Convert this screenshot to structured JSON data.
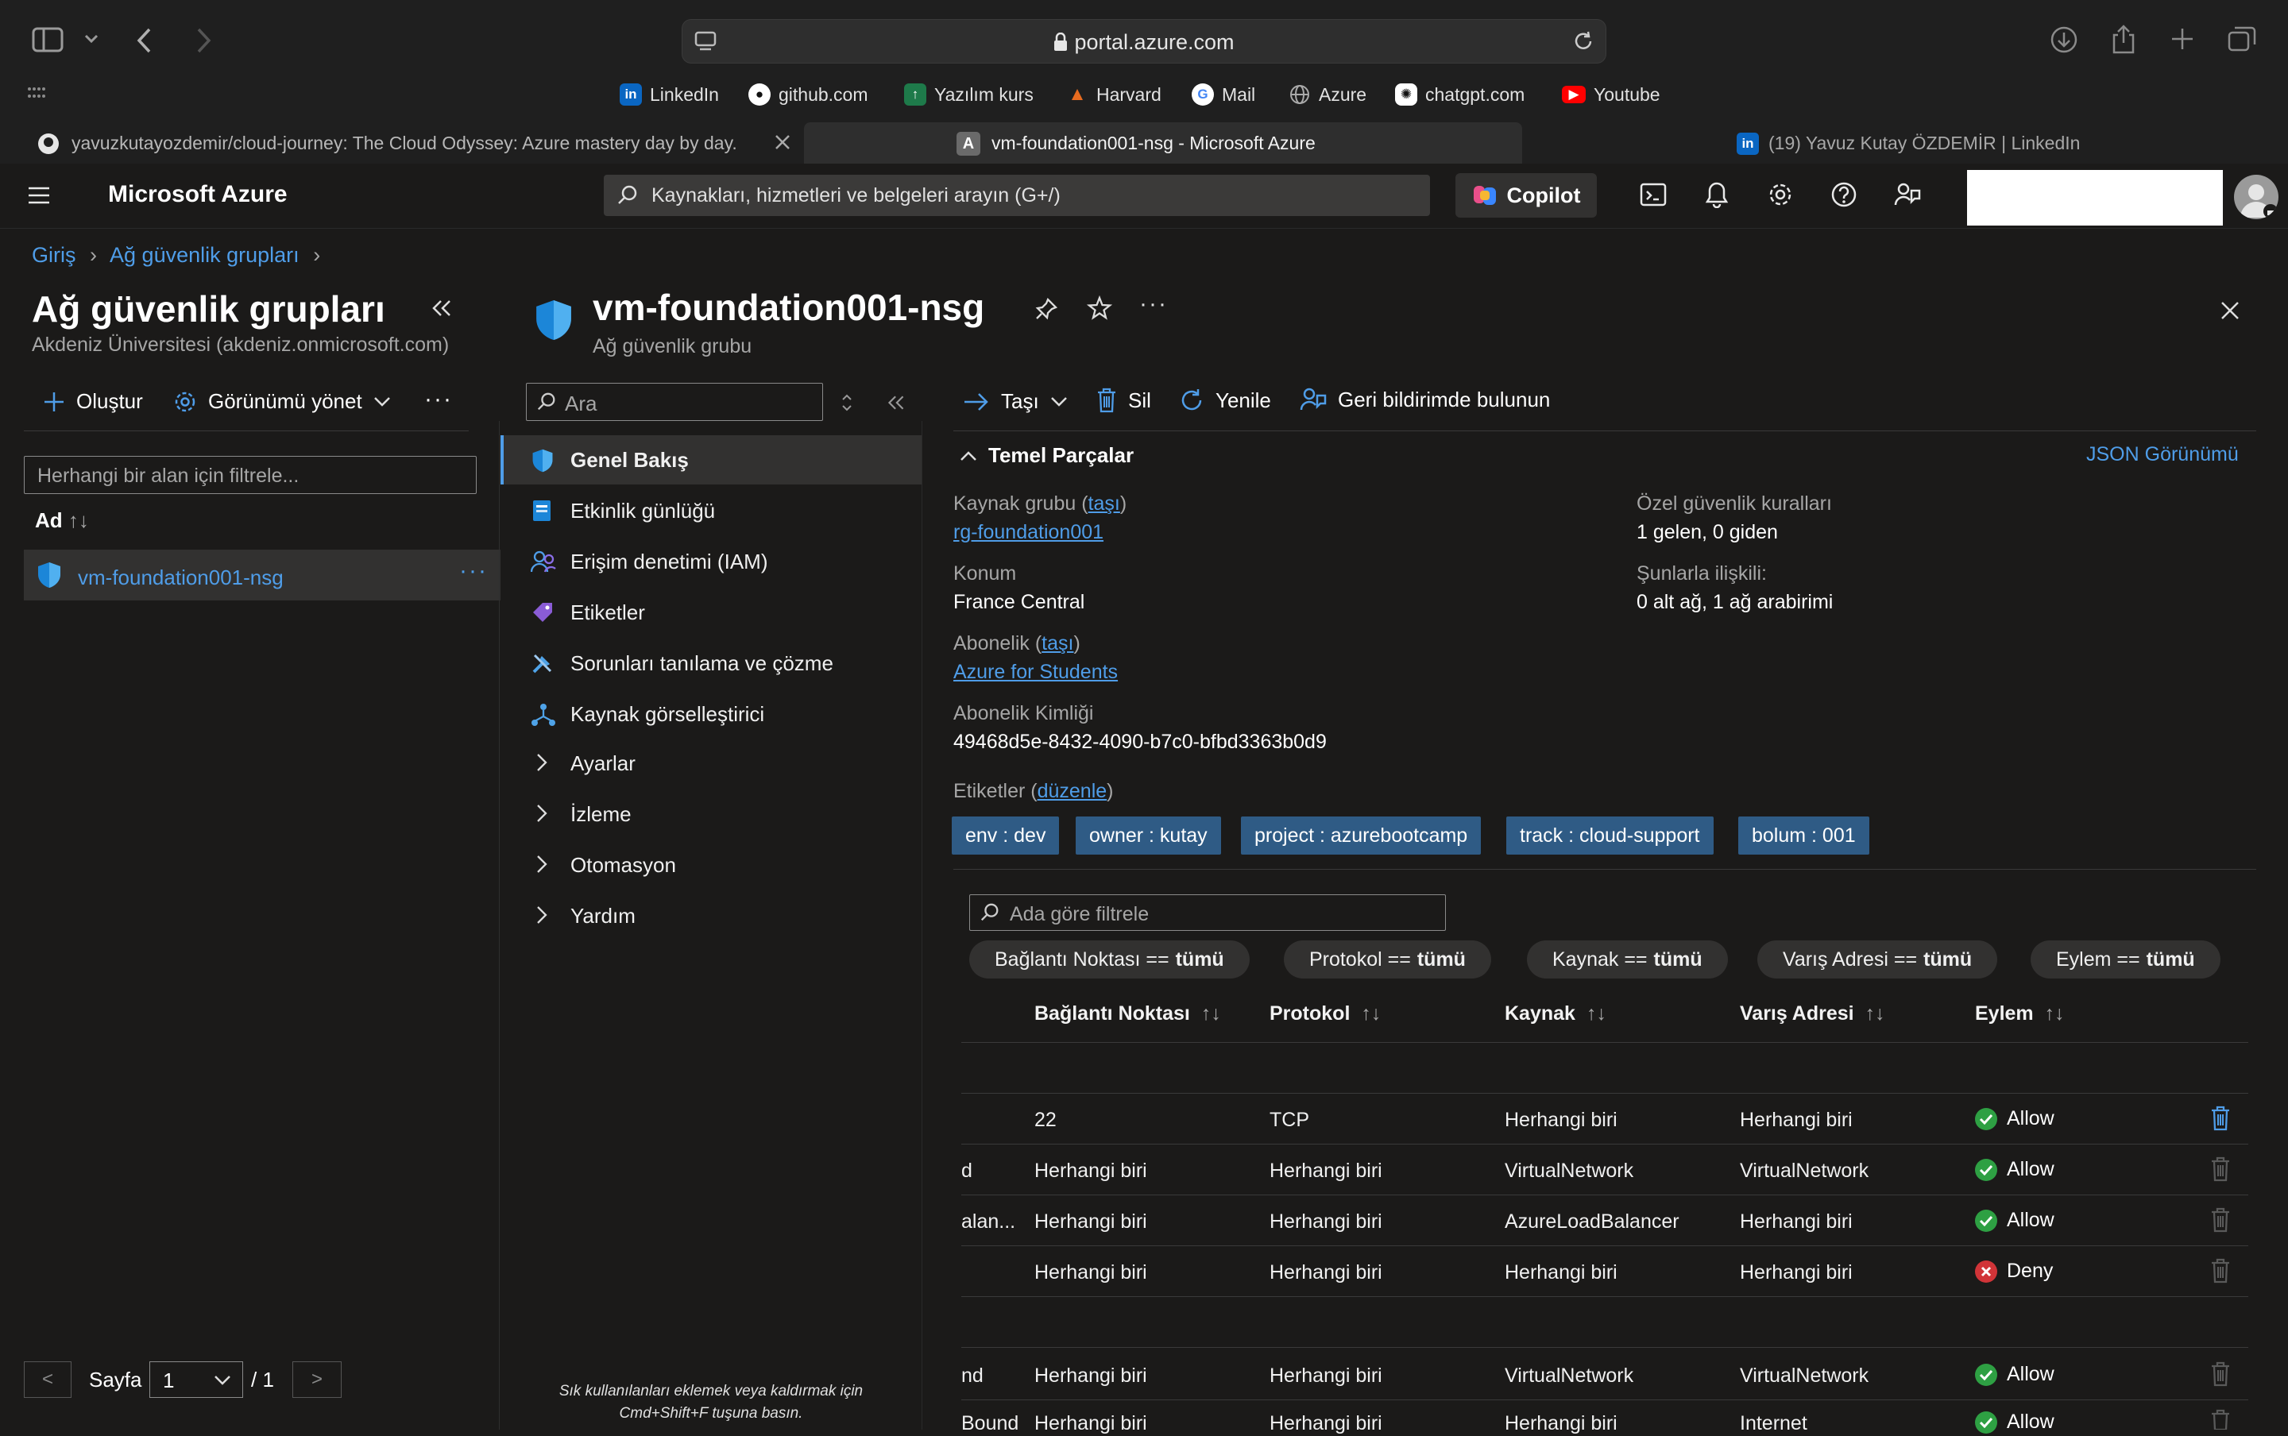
{
  "browser": {
    "url": "portal.azure.com",
    "favorites": [
      {
        "label": "LinkedIn",
        "icon": "linkedin-icon"
      },
      {
        "label": "github.com",
        "icon": "github-icon"
      },
      {
        "label": "Yazılım kurs",
        "icon": "bookmark-icon"
      },
      {
        "label": "Harvard",
        "icon": "harvard-icon"
      },
      {
        "label": "Mail",
        "icon": "google-icon"
      },
      {
        "label": "Azure",
        "icon": "globe-icon"
      },
      {
        "label": "chatgpt.com",
        "icon": "chatgpt-icon"
      },
      {
        "label": "Youtube",
        "icon": "youtube-icon"
      }
    ],
    "tabs": [
      {
        "title": "yavuzkutayozdemir/cloud-journey: The Cloud Odyssey: Azure mastery day by day."
      },
      {
        "title": "vm-foundation001-nsg - Microsoft Azure",
        "favicon": "A"
      },
      {
        "title": "(19) Yavuz Kutay ÖZDEMİR | LinkedIn"
      }
    ]
  },
  "header": {
    "brand": "Microsoft Azure",
    "search_placeholder": "Kaynakları, hizmetleri ve belgeleri arayın (G+/)",
    "copilot": "Copilot"
  },
  "breadcrumb": {
    "home": "Giriş",
    "section": "Ağ güvenlik grupları"
  },
  "list_pane": {
    "title": "Ağ güvenlik grupları",
    "subtitle": "Akdeniz Üniversitesi (akdeniz.onmicrosoft.com)",
    "create": "Oluştur",
    "manage_view": "Görünümü yönet",
    "filter_placeholder": "Herhangi bir alan için filtrele...",
    "col_name": "Ad",
    "items": [
      {
        "name": "vm-foundation001-nsg"
      }
    ],
    "page_label": "Sayfa",
    "page_value": "1",
    "page_total": "/ 1",
    "prev": "<",
    "next": ">"
  },
  "resource": {
    "title": "vm-foundation001-nsg",
    "subtitle": "Ağ güvenlik grubu",
    "search_placeholder": "Ara",
    "nav": [
      {
        "label": "Genel Bakış",
        "icon": "shield-icon",
        "active": true
      },
      {
        "label": "Etkinlik günlüğü",
        "icon": "activity-log-icon"
      },
      {
        "label": "Erişim denetimi (IAM)",
        "icon": "people-icon"
      },
      {
        "label": "Etiketler",
        "icon": "tag-icon"
      },
      {
        "label": "Sorunları tanılama ve çözme",
        "icon": "wrench-icon"
      },
      {
        "label": "Kaynak görselleştirici",
        "icon": "visualizer-icon"
      },
      {
        "label": "Ayarlar",
        "expandable": true
      },
      {
        "label": "İzleme",
        "expandable": true
      },
      {
        "label": "Otomasyon",
        "expandable": true
      },
      {
        "label": "Yardım",
        "expandable": true
      }
    ],
    "nav_hint_line1": "Sık kullanılanları eklemek veya kaldırmak için",
    "nav_hint_line2": "Cmd+Shift+F tuşuna basın."
  },
  "toolbar": {
    "move": "Taşı",
    "delete": "Sil",
    "refresh": "Yenile",
    "feedback": "Geri bildirimde bulunun"
  },
  "essentials": {
    "title": "Temel Parçalar",
    "json_view": "JSON Görünümü",
    "rg_label": "Kaynak grubu (",
    "move_link": "taşı",
    "close_paren": ")",
    "rg_value": "rg-foundation001",
    "location_label": "Konum",
    "location_value": "France Central",
    "sub_label": "Abonelik (",
    "sub_value": "Azure for Students",
    "sub_id_label": "Abonelik Kimliği",
    "sub_id_value": "49468d5e-8432-4090-b7c0-bfbd3363b0d9",
    "rules_label": "Özel güvenlik kuralları",
    "rules_value": "1 gelen, 0 giden",
    "assoc_label": "Şunlarla ilişkili:",
    "assoc_value": "0 alt ağ, 1 ağ arabirimi",
    "tags_label": "Etiketler (",
    "tags_edit": "düzenle",
    "tags": [
      "env : dev",
      "owner : kutay",
      "project : azurebootcamp",
      "track : cloud-support",
      "bolum : 001"
    ]
  },
  "rules": {
    "filter_placeholder": "Ada göre filtrele",
    "pills": [
      {
        "label": "Bağlantı Noktası ==",
        "value": "tümü"
      },
      {
        "label": "Protokol ==",
        "value": "tümü"
      },
      {
        "label": "Kaynak ==",
        "value": "tümü"
      },
      {
        "label": "Varış Adresi ==",
        "value": "tümü"
      },
      {
        "label": "Eylem ==",
        "value": "tümü"
      }
    ],
    "columns": [
      "Bağlantı Noktası",
      "Protokol",
      "Kaynak",
      "Varış Adresi",
      "Eylem"
    ],
    "rows": [
      {
        "name": "",
        "port": "22",
        "protocol": "TCP",
        "source": "Herhangi biri",
        "dest": "Herhangi biri",
        "action": "Allow",
        "status": "allow"
      },
      {
        "name": "d",
        "port": "Herhangi biri",
        "protocol": "Herhangi biri",
        "source": "VirtualNetwork",
        "dest": "VirtualNetwork",
        "action": "Allow",
        "status": "allow"
      },
      {
        "name": "alan...",
        "port": "Herhangi biri",
        "protocol": "Herhangi biri",
        "source": "AzureLoadBalancer",
        "dest": "Herhangi biri",
        "action": "Allow",
        "status": "allow"
      },
      {
        "name": "",
        "port": "Herhangi biri",
        "protocol": "Herhangi biri",
        "source": "Herhangi biri",
        "dest": "Herhangi biri",
        "action": "Deny",
        "status": "deny"
      },
      {
        "name": "nd",
        "port": "Herhangi biri",
        "protocol": "Herhangi biri",
        "source": "VirtualNetwork",
        "dest": "VirtualNetwork",
        "action": "Allow",
        "status": "allow"
      },
      {
        "name": "Bound",
        "port": "Herhangi biri",
        "protocol": "Herhangi biri",
        "source": "Herhangi biri",
        "dest": "Internet",
        "action": "Allow",
        "status": "allow"
      }
    ]
  },
  "colors": {
    "accent": "#4f9de8",
    "allow": "#2ea043",
    "deny": "#d13438",
    "tag_bg": "#2f5b85"
  }
}
